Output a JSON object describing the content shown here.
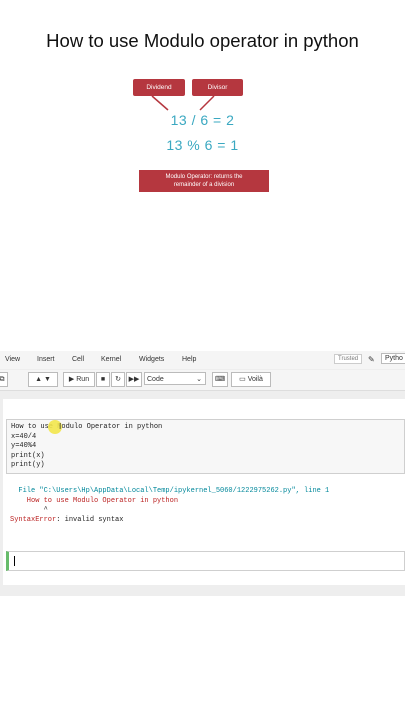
{
  "title": "How to use Modulo operator in python",
  "diagram": {
    "dividend_label": "Dividend",
    "divisor_label": "Divisor",
    "equation1": "13 / 6 = 2",
    "equation2": "13 % 6 = 1",
    "note_line1": "Modulo Operator: returns the",
    "note_line2": "remainder of a division",
    "tag_color": "#b5373f",
    "equation_color": "#3aa8c1"
  },
  "jupyter": {
    "menu": [
      "View",
      "Insert",
      "Cell",
      "Kernel",
      "Widgets",
      "Help"
    ],
    "trusted": "Trusted",
    "kernel": "Pytho",
    "toolbar": {
      "run_label": "Run",
      "cell_type": "Code",
      "voila": "Voilà"
    },
    "input_lines": [
      "How to use Modulo Operator in python",
      "x=40/4",
      "y=40%4",
      "print(x)",
      "print(y)"
    ],
    "output_lines": {
      "file": "  File \"C:\\Users\\Hp\\AppData\\Local\\Temp/ipykernel_5060/1222975262.py\", line 1",
      "code": "    How to use Modulo Operator in python",
      "pointer": "        ^",
      "error_name": "SyntaxError",
      "error_msg": ": invalid syntax"
    }
  }
}
